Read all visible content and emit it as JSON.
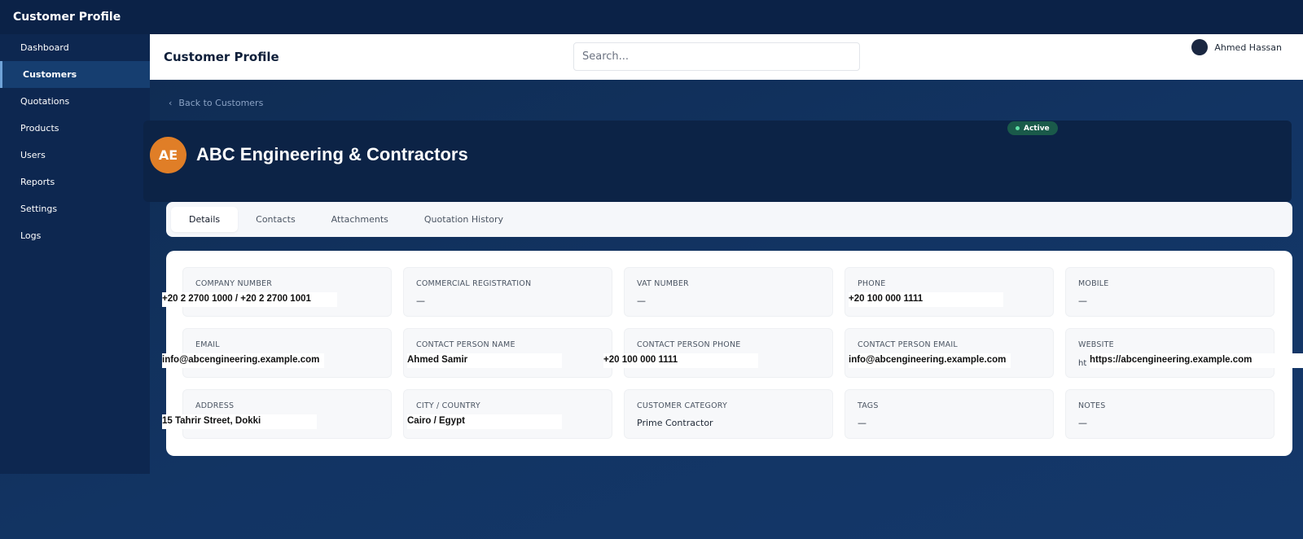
{
  "app": {
    "title": "Customer Profile"
  },
  "sidebar": {
    "items": [
      {
        "label": "Dashboard"
      },
      {
        "label": "Customers"
      },
      {
        "label": "Quotations"
      },
      {
        "label": "Products"
      },
      {
        "label": "Users"
      },
      {
        "label": "Reports"
      },
      {
        "label": "Settings"
      },
      {
        "label": "Logs"
      }
    ]
  },
  "header": {
    "title": "Customer Profile",
    "search_placeholder": "Search...",
    "user_name": "Ahmed Hassan"
  },
  "back_link": {
    "label": "Back to Customers"
  },
  "customer": {
    "initials": "AE",
    "name": "ABC Engineering & Contractors",
    "status": "Active"
  },
  "tabs": [
    {
      "label": "Details"
    },
    {
      "label": "Contacts"
    },
    {
      "label": "Attachments"
    },
    {
      "label": "Quotation History"
    }
  ],
  "fields": {
    "company_number": {
      "label": "COMPANY NUMBER",
      "value": "+20 2 2700 1000 / +20 2 2700 1001"
    },
    "commercial_registration": {
      "label": "COMMERCIAL REGISTRATION",
      "value": "—"
    },
    "vat_number": {
      "label": "VAT NUMBER",
      "value": "—"
    },
    "phone": {
      "label": "PHONE",
      "value": "+20 100 000 1111"
    },
    "mobile": {
      "label": "MOBILE",
      "value": "—"
    },
    "email": {
      "label": "EMAIL",
      "value": "info@abcengineering.example.com"
    },
    "contact_person_name": {
      "label": "CONTACT PERSON NAME",
      "value": "Ahmed Samir"
    },
    "contact_person_phone": {
      "label": "CONTACT PERSON PHONE",
      "value": "+20 100 000 1111"
    },
    "contact_person_email": {
      "label": "CONTACT PERSON EMAIL",
      "value": "info@abcengineering.example.com"
    },
    "website": {
      "label": "WEBSITE",
      "value": "https://abcengineering.example.com",
      "stub": "ht"
    },
    "address": {
      "label": "ADDRESS",
      "value": "15 Tahrir Street, Dokki"
    },
    "city_country": {
      "label": "CITY / COUNTRY",
      "value": "Cairo / Egypt"
    },
    "customer_category": {
      "label": "CUSTOMER CATEGORY",
      "value": "Prime Contractor"
    },
    "tags": {
      "label": "TAGS",
      "value": "—"
    },
    "notes": {
      "label": "NOTES",
      "value": "—"
    }
  },
  "colors": {
    "accent_avatar": "#e07e27",
    "status_badge": "#1a5a4a",
    "sidebar_bg": "#0d2750",
    "sidebar_active": "#163e70"
  }
}
